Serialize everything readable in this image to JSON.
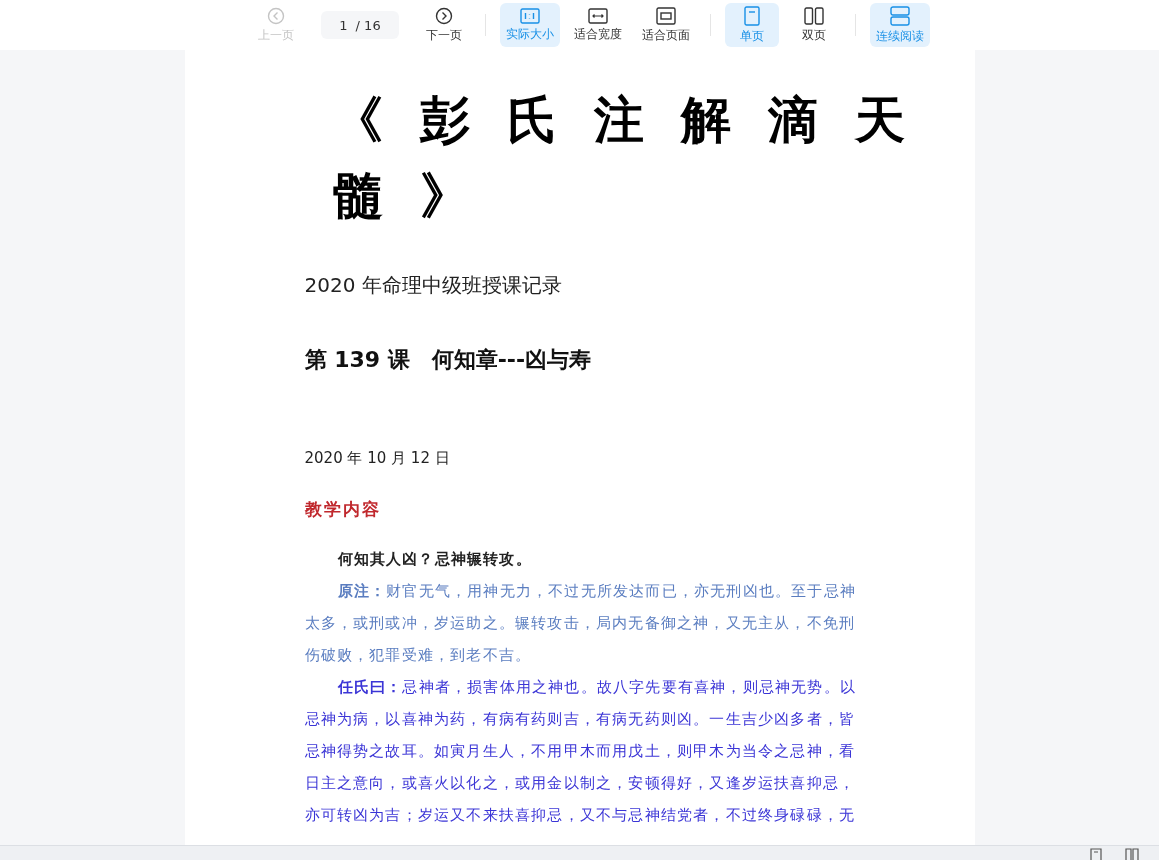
{
  "toolbar": {
    "items": [
      {
        "kind": "nav",
        "label": "上一页",
        "disabled": true,
        "selected": false
      },
      {
        "kind": "page",
        "value": "1",
        "total": "/ 16"
      },
      {
        "kind": "nav",
        "label": "下一页",
        "disabled": false,
        "selected": false
      },
      {
        "kind": "sep"
      },
      {
        "kind": "nav",
        "label": "实际大小",
        "disabled": false,
        "selected": true
      },
      {
        "kind": "nav",
        "label": "适合宽度",
        "disabled": false,
        "selected": false
      },
      {
        "kind": "nav",
        "label": "适合页面",
        "disabled": false,
        "selected": false
      },
      {
        "kind": "sep"
      },
      {
        "kind": "nav",
        "label": "单页",
        "disabled": false,
        "selected": true
      },
      {
        "kind": "nav",
        "label": "双页",
        "disabled": false,
        "selected": false
      },
      {
        "kind": "sep"
      },
      {
        "kind": "nav",
        "label": "连续阅读",
        "disabled": false,
        "selected": true
      }
    ]
  },
  "document": {
    "title": "《彭氏注解滴天髓》",
    "subtitle": "2020 年命理中级班授课记录",
    "lesson": "第 139 课　何知章---凶与寿",
    "date": "2020 年 10 月 12 日",
    "section": "教学内容",
    "paragraphs": [
      {
        "kind": "quote",
        "text": "何知其人凶？忌神辗转攻。",
        "color": "#222222"
      },
      {
        "kind": "body",
        "text": "**原注：**财官无气，用神无力，不过无所发达而已，亦无刑凶也。至于忌神太多，或刑或冲，岁运助之。辗转攻击，局内无备御之神，又无主从，不免刑伤破败，犯罪受难，到老不吉。",
        "color": "#5a7dc0"
      },
      {
        "kind": "body",
        "text": "**任氏曰：**忌神者，损害体用之神也。故八字先要有喜神，则忌神无势。以忌神为病，以喜神为药，有病有药则吉，有病无药则凶。一生吉少凶多者，皆忌神得势之故耳。如寅月生人，不用甲木而用戊土，则甲木为当令之忌神，看日主之意向，或喜火以化之，或用金以制之，安顿得好，又逢岁运扶喜抑忌，亦可转凶为吉；岁运又不来扶喜抑忌，又不与忌神结党者，不过终身碌碌，无",
        "color": "#3b35d6"
      }
    ]
  }
}
